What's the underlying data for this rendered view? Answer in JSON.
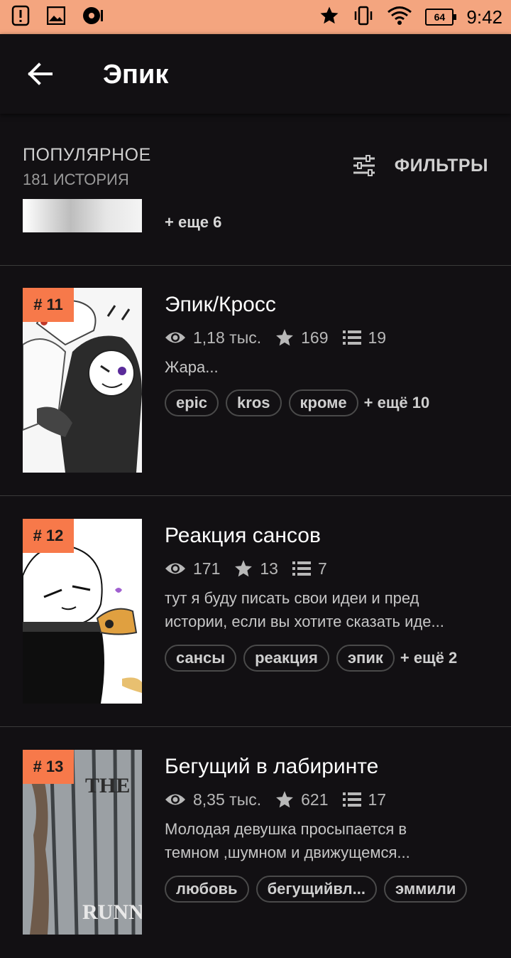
{
  "status_bar": {
    "time": "9:42",
    "battery": "64",
    "icons": [
      "alert-icon",
      "image-icon",
      "music-icon",
      "star-icon",
      "vibrate-icon",
      "wifi-icon",
      "battery-icon"
    ]
  },
  "app_bar": {
    "title": "Эпик",
    "back_icon": "arrow-left-icon"
  },
  "section": {
    "title": "ПОПУЛЯРНОЕ",
    "count": "181 ИСТОРИЯ",
    "filter_label": "ФИЛЬТРЫ",
    "filter_icon": "sliders-icon"
  },
  "partial_item": {
    "more_tags": "+ еще 6"
  },
  "stories": [
    {
      "rank": "# 11",
      "title": "Эпик/Кросс",
      "views": "1,18 тыс.",
      "votes": "169",
      "parts": "19",
      "description": [
        "Жара..."
      ],
      "tags": [
        "epic",
        "kros",
        "кроме"
      ],
      "more_tags": "+ ещё 10"
    },
    {
      "rank": "# 12",
      "title": "Реакция сансов",
      "views": "171",
      "votes": "13",
      "parts": "7",
      "description": [
        "тут я буду писать свои идеи и пред",
        "истории, если вы хотите сказать иде..."
      ],
      "tags": [
        "сансы",
        "реакция",
        "эпик"
      ],
      "more_tags": "+ ещё 2"
    },
    {
      "rank": "# 13",
      "title": "Бегущий в лабиринте",
      "views": "8,35 тыс.",
      "votes": "621",
      "parts": "17",
      "description": [
        "Молодая девушка просыпается в",
        "темном ,шумном и движущемся..."
      ],
      "tags": [
        "любовь",
        "бегущийвл...",
        "эммили"
      ],
      "more_tags": "",
      "cover_text": [
        "THE",
        "RUNN"
      ]
    }
  ],
  "colors": {
    "background": "#121013",
    "status_bar": "#f4a57f",
    "rank_badge": "#f7794a",
    "tag_border": "#4a4a4a"
  }
}
